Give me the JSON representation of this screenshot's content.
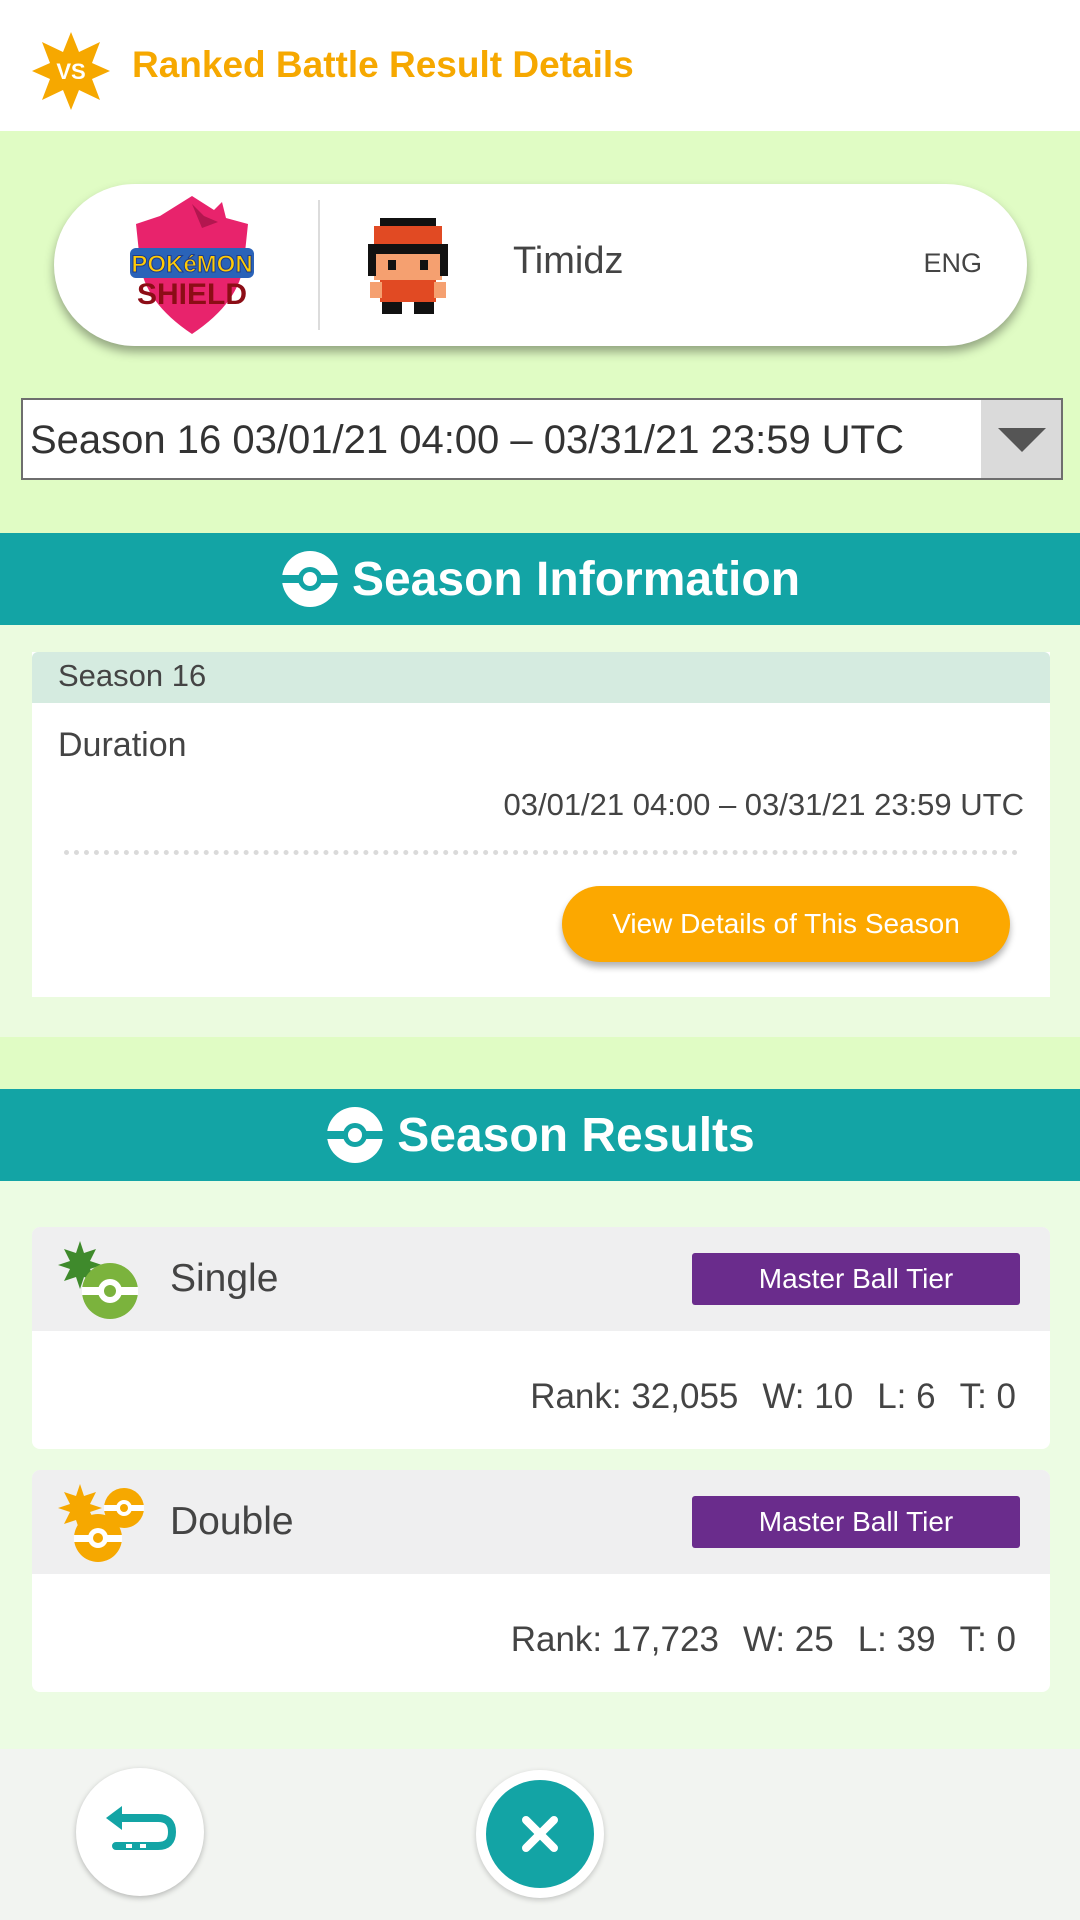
{
  "header": {
    "badge_text": "VS",
    "title": "Ranked Battle Result Details"
  },
  "player": {
    "game_logo_top": "POKéMON",
    "game_logo_bottom": "SHIELD",
    "name": "Timidz",
    "language": "ENG"
  },
  "season_selector": {
    "selected": "Season 16 03/01/21 04:00 – 03/31/21 23:59 UTC"
  },
  "season_information": {
    "heading": "Season Information",
    "season_label": "Season 16",
    "duration_label": "Duration",
    "duration_value": "03/01/21 04:00 – 03/31/21 23:59 UTC",
    "details_button": "View Details of This Season"
  },
  "season_results": {
    "heading": "Season Results",
    "modes": [
      {
        "label": "Single",
        "tier": "Master Ball Tier",
        "rank": "Rank: 32,055",
        "wins": "W: 10",
        "losses": "L: 6",
        "ties": "T: 0",
        "icon": "single-battle-icon"
      },
      {
        "label": "Double",
        "tier": "Master Ball Tier",
        "rank": "Rank: 17,723",
        "wins": "W: 25",
        "losses": "L: 39",
        "ties": "T: 0",
        "icon": "double-battle-icon"
      }
    ]
  },
  "colors": {
    "accent_orange": "#f6a800",
    "teal": "#13a4a5",
    "tier_purple": "#6a2c8c",
    "light_green": "#e0fcc4"
  },
  "footer": {
    "back_icon": "back-arrow-icon",
    "close_icon": "close-icon"
  }
}
